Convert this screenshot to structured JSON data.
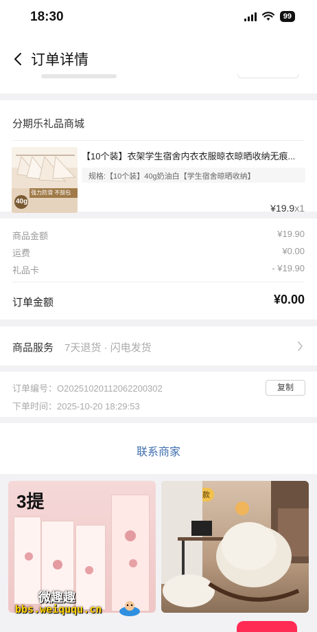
{
  "status_bar": {
    "time": "18:30",
    "battery": "99"
  },
  "nav": {
    "title": "订单详情"
  },
  "store": {
    "name": "分期乐礼品商城"
  },
  "product": {
    "title": "【10个装】衣架学生宿舍内衣衣服晾衣晾晒收纳无痕...",
    "spec": "规格:【10个装】40g奶油白【学生宿舍晾晒收纳】",
    "price": "¥19.9",
    "qty": "x1",
    "thumb_badge_weight": "40g",
    "thumb_badge_text": "强力防滑 不鼓包"
  },
  "amounts": {
    "rows": [
      {
        "label": "商品金额",
        "value": "¥19.90"
      },
      {
        "label": "运费",
        "value": "¥0.00"
      },
      {
        "label": "礼品卡",
        "value": "- ¥19.90"
      }
    ],
    "total_label": "订单金额",
    "total_value": "¥0.00"
  },
  "services": {
    "label": "商品服务",
    "value": "7天退货 · 闪电发货"
  },
  "order_info": {
    "order_no": "订单编号：O20251020112062200302",
    "order_time": "下单时间：2025-10-20 18:29:53",
    "copy_label": "复制"
  },
  "contact": {
    "label": "联系商家"
  },
  "recommendations": [
    {
      "badge": "3提"
    },
    {
      "badge": "标准加大款"
    }
  ],
  "watermark": {
    "line1": "微趣趣",
    "line2": "bbs.weiququ.cn"
  },
  "colors": {
    "accent_blue": "#3f6fae",
    "bottom_button": "#ff2b55",
    "badge_yellow": "#f2c24e"
  }
}
